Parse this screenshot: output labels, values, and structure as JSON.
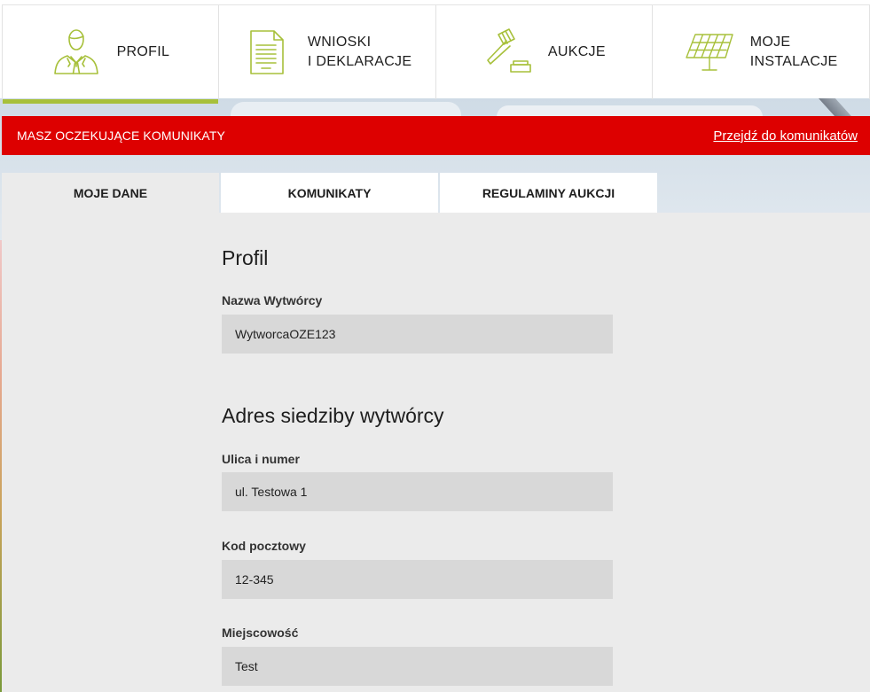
{
  "nav": {
    "items": [
      {
        "label": "PROFIL",
        "icon": "person-icon"
      },
      {
        "label": "WNIOSKI\nI DEKLARACJE",
        "icon": "document-icon"
      },
      {
        "label": "AUKCJE",
        "icon": "gavel-icon"
      },
      {
        "label": "MOJE\nINSTALACJE",
        "icon": "solar-panel-icon"
      }
    ],
    "active_index": 0
  },
  "notification": {
    "message": "MASZ OCZEKUJĄCE KOMUNIKATY",
    "link": "Przejdź do komunikatów"
  },
  "tabs": [
    {
      "label": "MOJE DANE"
    },
    {
      "label": "KOMUNIKATY"
    },
    {
      "label": "REGULAMINY AUKCJI"
    }
  ],
  "profile": {
    "title": "Profil",
    "name_label": "Nazwa Wytwórcy",
    "name_value": "WytworcaOZE123"
  },
  "address": {
    "title": "Adres siedziby wytwórcy",
    "street_label": "Ulica i numer",
    "street_value": "ul. Testowa 1",
    "postal_label": "Kod pocztowy",
    "postal_value": "12-345",
    "city_label": "Miejscowość",
    "city_value": "Test"
  },
  "colors": {
    "accent_green": "#a7c03a",
    "alert_red": "#dd0000",
    "panel_gray": "#ebebeb",
    "field_gray": "#d8d8d8"
  }
}
